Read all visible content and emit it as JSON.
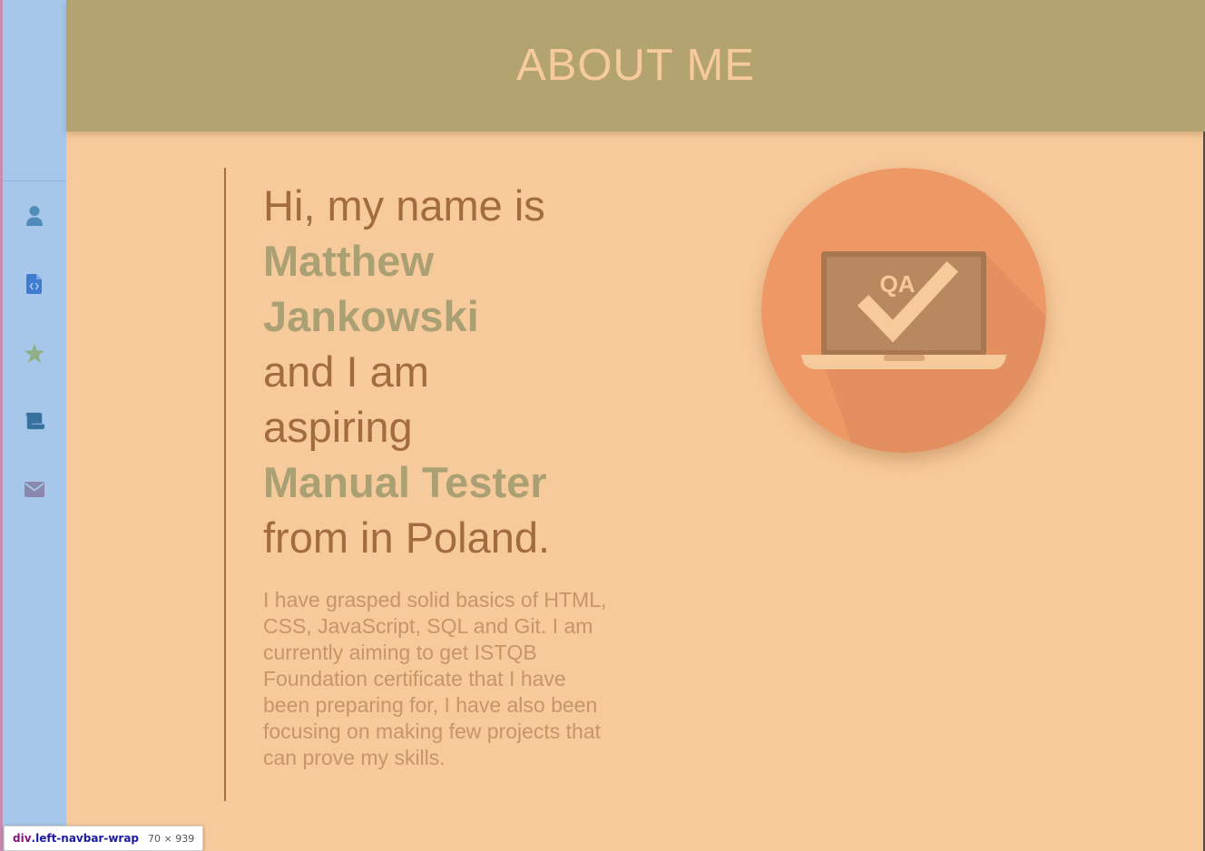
{
  "header": {
    "title": "ABOUT ME",
    "background": "#b3a46f",
    "title_color": "#f7ca9b"
  },
  "sidebar": {
    "background": "#a6c7ea",
    "items": [
      {
        "icon": "user-icon",
        "color": "#4f8db8"
      },
      {
        "icon": "file-code-icon",
        "color": "#3f7bd0"
      },
      {
        "icon": "star-icon",
        "color": "#8faf87"
      },
      {
        "icon": "scroll-icon",
        "color": "#37719e"
      },
      {
        "icon": "envelope-icon",
        "color": "#8a88ac"
      }
    ]
  },
  "intro": {
    "line1": "Hi, my name is",
    "first_name": "Matthew",
    "last_name": "Jankowski",
    "line2": "and I am",
    "line3": "aspiring",
    "role": "Manual Tester",
    "line4": "from in Poland.",
    "text_color": "#a26c40",
    "highlight_color": "#aaa074"
  },
  "bio": {
    "text": "I have grasped solid basics of HTML, CSS, JavaScript, SQL and Git. I am currently aiming to get ISTQB Foundation certificate that I have been preparing for, I have also been focusing on making few projects that can prove my skills."
  },
  "qa_image": {
    "label": "QA",
    "circle_color": "#ed9865",
    "laptop_color": "#b8895f",
    "check_color": "#f7ca9b"
  },
  "devtools_tooltip": {
    "tag": "div",
    "class_name": ".left-navbar-wrap",
    "size": "70 × 939"
  },
  "page_background": "#f7ca9b"
}
